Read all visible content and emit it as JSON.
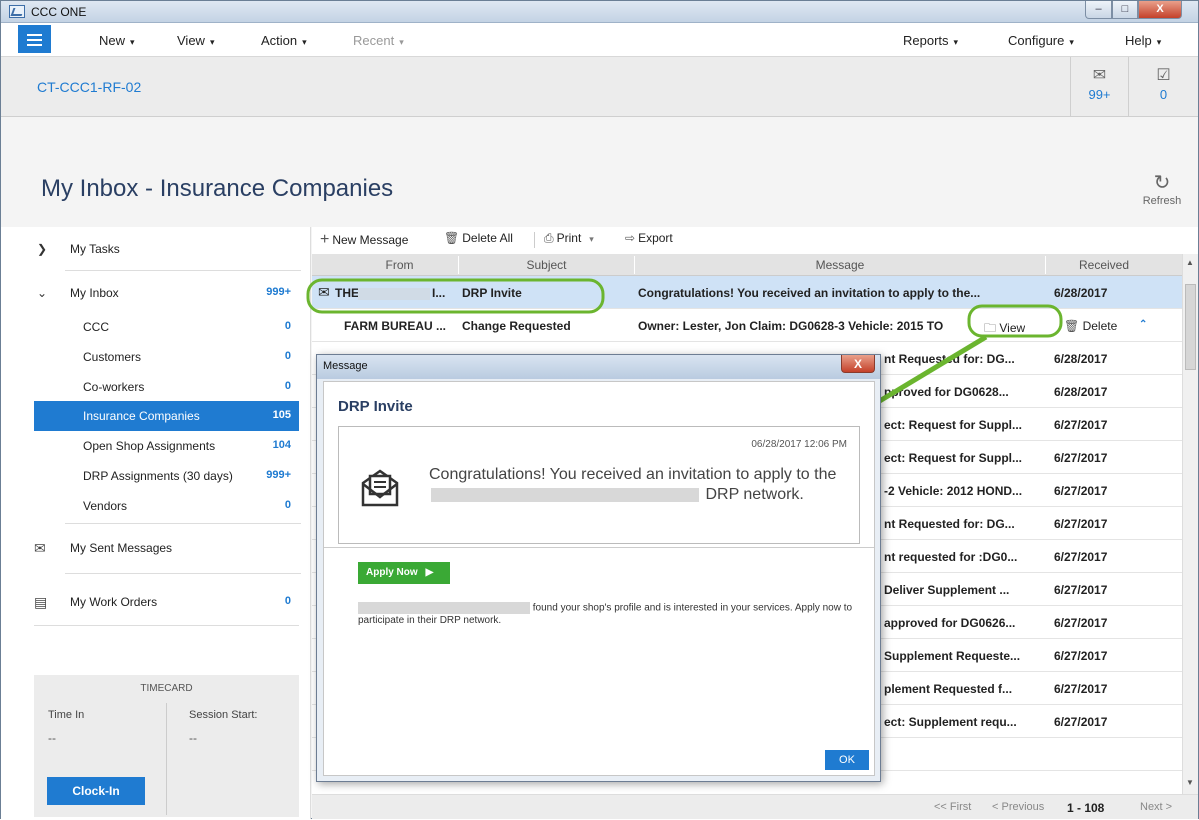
{
  "app": {
    "title": "CCC ONE",
    "window_buttons": {
      "minimize": "–",
      "maximize": "□",
      "close": "X"
    }
  },
  "menu": {
    "items": [
      {
        "label": "New",
        "caret": "▾"
      },
      {
        "label": "View",
        "caret": "▾"
      },
      {
        "label": "Action",
        "caret": "▾"
      },
      {
        "label": "Recent",
        "caret": "▾"
      },
      {
        "label": "Reports",
        "caret": "▾"
      },
      {
        "label": "Configure",
        "caret": "▾"
      },
      {
        "label": "Help",
        "caret": "▾"
      }
    ]
  },
  "account": {
    "id": "CT-CCC1-RF-02",
    "messages_count": "99+",
    "tasks_count": "0"
  },
  "page": {
    "title": "My Inbox - Insurance Companies",
    "refresh_label": "Refresh"
  },
  "sidebar": {
    "items": [
      {
        "label": "My Tasks",
        "count": ""
      },
      {
        "label": "My Inbox",
        "count": "999+"
      },
      {
        "label": "CCC",
        "count": "0"
      },
      {
        "label": "Customers",
        "count": "0"
      },
      {
        "label": "Co-workers",
        "count": "0"
      },
      {
        "label": "Insurance Companies",
        "count": "105"
      },
      {
        "label": "Open Shop Assignments",
        "count": "104"
      },
      {
        "label": "DRP Assignments (30 days)",
        "count": "999+"
      },
      {
        "label": "Vendors",
        "count": "0"
      },
      {
        "label": "My Sent Messages",
        "count": ""
      },
      {
        "label": "My Work Orders",
        "count": "0"
      }
    ],
    "timecard": {
      "title": "TIMECARD",
      "time_in_label": "Time In",
      "time_in_value": "--",
      "session_label": "Session Start:",
      "session_value": "--",
      "clock_in": "Clock-In"
    }
  },
  "toolbar": {
    "new_message": "New Message",
    "delete_all": "Delete All",
    "print": "Print",
    "export": "Export"
  },
  "table": {
    "headers": {
      "from": "From",
      "subject": "Subject",
      "message": "Message",
      "received": "Received"
    },
    "rows": [
      {
        "from": "THE I",
        "from_tail": "I...",
        "subject": "DRP Invite",
        "message": "Congratulations! You received an invitation to apply to the...",
        "received": "6/28/2017"
      },
      {
        "from": "FARM BUREAU ...",
        "subject": "Change Requested",
        "message": "Owner: Lester, Jon Claim: DG0628-3 Vehicle: 2015 TO",
        "received": ""
      },
      {
        "message": "nt Requested for: DG...",
        "received": "6/28/2017"
      },
      {
        "message": "pproved for DG0628...",
        "received": "6/28/2017"
      },
      {
        "message": "ect: Request for Suppl...",
        "received": "6/27/2017"
      },
      {
        "message": "ect: Request for Suppl...",
        "received": "6/27/2017"
      },
      {
        "message": "-2 Vehicle: 2012 HOND...",
        "received": "6/27/2017"
      },
      {
        "message": "nt Requested for: DG...",
        "received": "6/27/2017"
      },
      {
        "message": "nt requested for :DG0...",
        "received": "6/27/2017"
      },
      {
        "message": "Deliver Supplement ...",
        "received": "6/27/2017"
      },
      {
        "message": "approved for DG0626...",
        "received": "6/27/2017"
      },
      {
        "message": "Supplement Requeste...",
        "received": "6/27/2017"
      },
      {
        "message": "plement Requested f...",
        "received": "6/27/2017"
      },
      {
        "message": "ect: Supplement requ...",
        "received": "6/27/2017"
      },
      {
        "message": "",
        "received": ""
      }
    ],
    "row_actions": {
      "view": "View",
      "delete": "Delete"
    }
  },
  "pager": {
    "first": "<< First",
    "previous": "< Previous",
    "range": "1 - 108",
    "next": "Next >"
  },
  "dialog": {
    "title": "Message",
    "subject": "DRP Invite",
    "date": "06/28/2017 12:06 PM",
    "text_pre": "Congratulations!  You received an invitation to apply to the",
    "text_post": "DRP network.",
    "apply_button": "Apply Now",
    "paragraph": "found your shop's profile and is interested in your services. Apply now to participate in their DRP network.",
    "ok": "OK"
  },
  "colors": {
    "accent": "#1f7bd1",
    "apply_green": "#3aa935",
    "highlight_green": "#6bb52f"
  }
}
